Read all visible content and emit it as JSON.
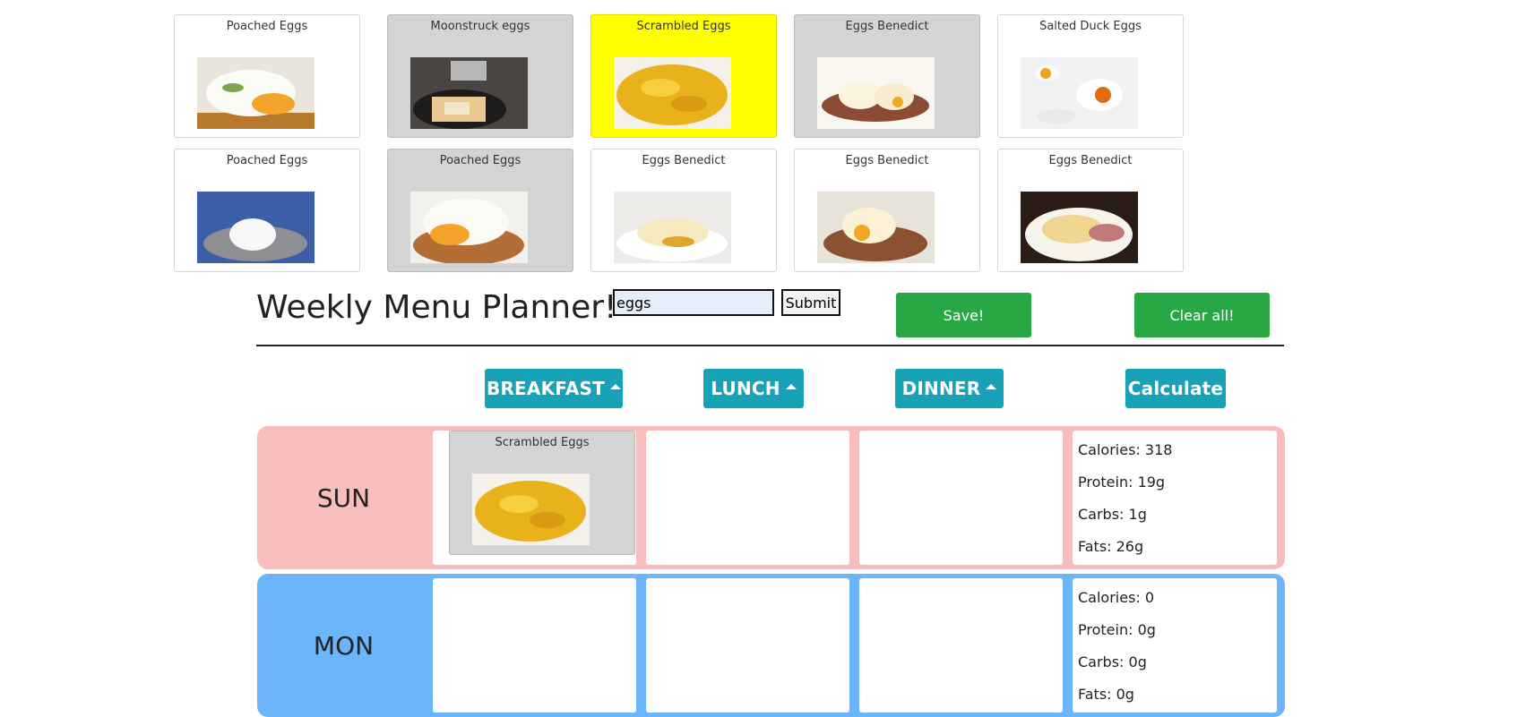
{
  "search_results": [
    {
      "title": "Poached Eggs",
      "style": "white",
      "image": "poached-eggs-image"
    },
    {
      "title": "Moonstruck eggs",
      "style": "grey",
      "image": "moonstruck-eggs-image"
    },
    {
      "title": "Scrambled Eggs",
      "style": "yellow",
      "image": "scrambled-eggs-image"
    },
    {
      "title": "Eggs Benedict",
      "style": "grey",
      "image": "eggs-benedict-image"
    },
    {
      "title": "Salted Duck Eggs",
      "style": "white",
      "image": "salted-duck-eggs-image"
    },
    {
      "title": "Poached Eggs",
      "style": "white",
      "image": "poached-eggs-image"
    },
    {
      "title": "Poached Eggs",
      "style": "grey",
      "image": "poached-eggs-image"
    },
    {
      "title": "Eggs Benedict",
      "style": "white",
      "image": "eggs-benedict-image"
    },
    {
      "title": "Eggs Benedict",
      "style": "white",
      "image": "eggs-benedict-image"
    },
    {
      "title": "Eggs Benedict",
      "style": "white",
      "image": "eggs-benedict-image"
    }
  ],
  "header": {
    "title": "Weekly Menu Planner!",
    "search_value": "eggs",
    "submit_label": "Submit",
    "save_label": "Save!",
    "clear_label": "Clear all!"
  },
  "columns": {
    "breakfast": "BREAKFAST",
    "lunch": "LUNCH",
    "dinner": "DINNER",
    "calculate": "Calculate"
  },
  "days": [
    {
      "label": "SUN",
      "color": "#f8bdbd",
      "breakfast": {
        "title": "Scrambled Eggs",
        "image": "scrambled-eggs-image"
      },
      "stats": {
        "calories": "Calories: 318",
        "protein": "Protein: 19g",
        "carbs": "Carbs: 1g",
        "fats": "Fats: 26g"
      }
    },
    {
      "label": "MON",
      "color": "#6cb4fc",
      "stats": {
        "calories": "Calories: 0",
        "protein": "Protein: 0g",
        "carbs": "Carbs: 0g",
        "fats": "Fats: 0g"
      }
    }
  ],
  "colors": {
    "selected_card": "#ffff00",
    "grey_card": "#d4d4d4",
    "green_button": "#28a745",
    "teal_button": "#17a2b8"
  }
}
